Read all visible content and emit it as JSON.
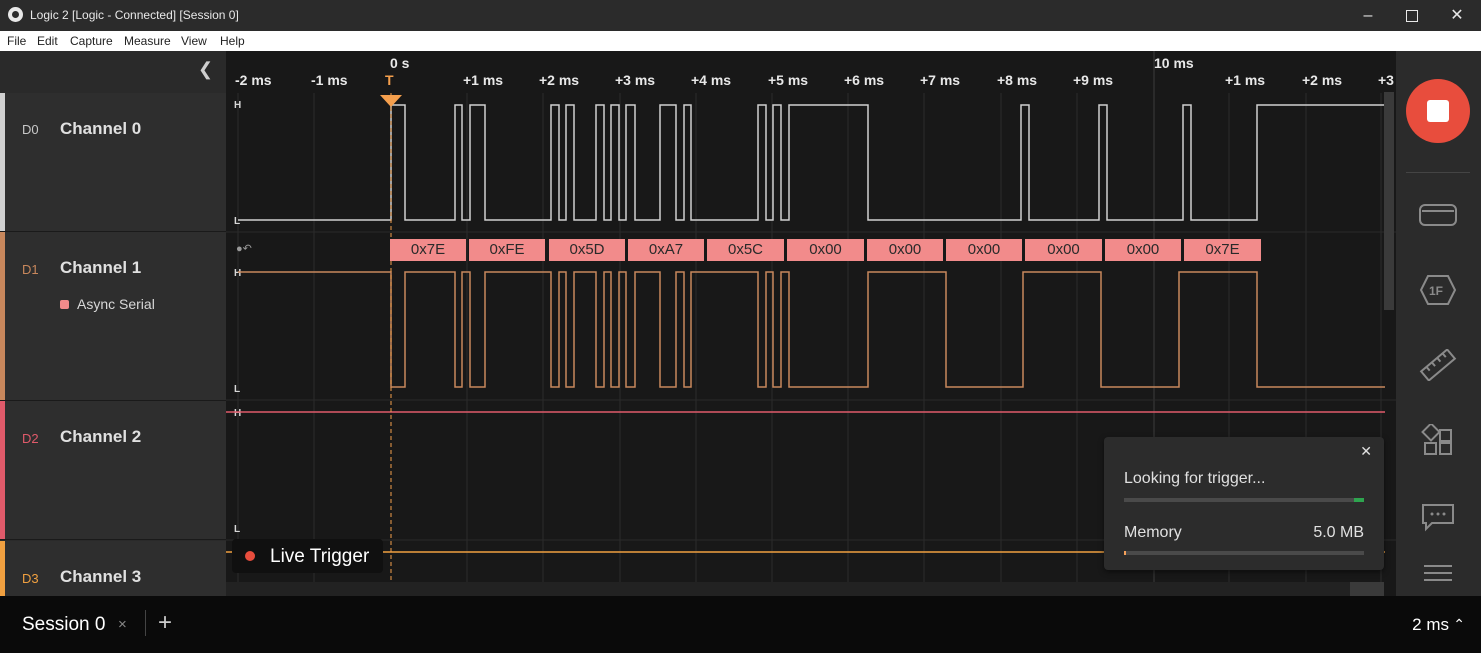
{
  "window": {
    "title": "Logic 2 [Logic - Connected] [Session 0]"
  },
  "menu": [
    "File",
    "Edit",
    "Capture",
    "Measure",
    "View",
    "Help"
  ],
  "channels": [
    {
      "id": "D0",
      "name": "Channel 0",
      "color": "#d0d0d0"
    },
    {
      "id": "D1",
      "name": "Channel 1",
      "color": "#c8875c",
      "analyzer": "Async Serial"
    },
    {
      "id": "D2",
      "name": "Channel 2",
      "color": "#e05a6a"
    },
    {
      "id": "D3",
      "name": "Channel 3",
      "color": "#f0a040"
    }
  ],
  "timeline": {
    "origin_label": "0 s",
    "mid_label": "10 ms",
    "ticks": [
      "-2 ms",
      "-1 ms",
      "+1 ms",
      "+2 ms",
      "+3 ms",
      "+4 ms",
      "+5 ms",
      "+6 ms",
      "+7 ms",
      "+8 ms",
      "+9 ms",
      "+1 ms",
      "+2 ms",
      "+3"
    ],
    "trigger_marker": "T"
  },
  "levels": {
    "high": "H",
    "low": "L"
  },
  "decoded_frames": [
    "0x7E",
    "0xFE",
    "0x5D",
    "0xA7",
    "0x5C",
    "0x00",
    "0x00",
    "0x00",
    "0x00",
    "0x00",
    "0x7E"
  ],
  "capture_status": {
    "status": "Looking for trigger...",
    "memory_label": "Memory",
    "memory_value": "5.0 MB",
    "trigger_progress": 0.04,
    "memory_progress": 0.01
  },
  "live_trigger": "Live Trigger",
  "session": {
    "tab": "Session 0",
    "close": "×",
    "add": "+",
    "zoom": "2 ms"
  },
  "rightbar_icons": [
    "stop-icon",
    "device-icon",
    "analyzer-1f-icon",
    "ruler-icon",
    "extensions-icon",
    "comment-icon",
    "menu-icon"
  ],
  "colors": {
    "accent_stop": "#e84d3d",
    "frame_fill": "#f28b8b",
    "trigger": "#f59f4d"
  }
}
